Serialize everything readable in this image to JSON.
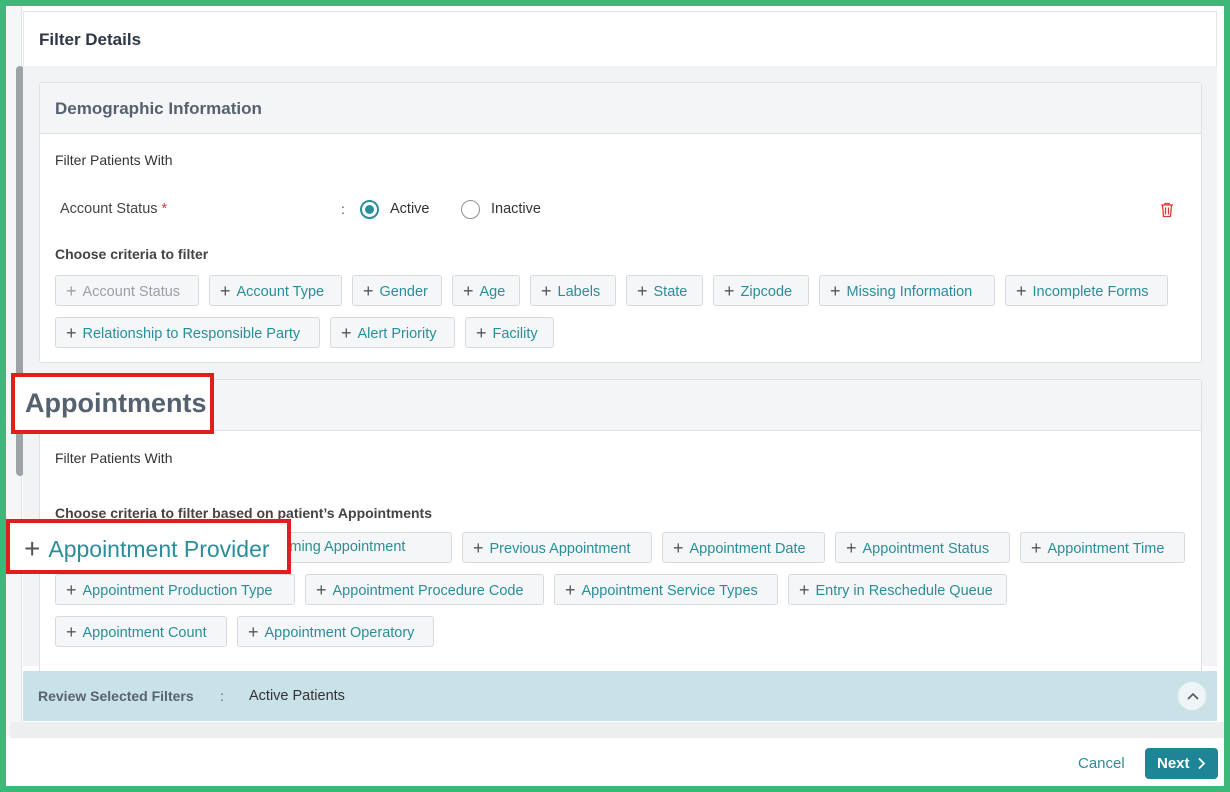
{
  "header": {
    "title": "Filter Details"
  },
  "demographic": {
    "title": "Demographic Information",
    "filter_with": "Filter Patients With",
    "account_status": {
      "label": "Account Status",
      "required_mark": "*",
      "separator": ":",
      "options": [
        {
          "label": "Active",
          "selected": true
        },
        {
          "label": "Inactive",
          "selected": false
        }
      ]
    },
    "criteria_heading": "Choose criteria to filter",
    "chips": [
      "Account Status",
      "Account Type",
      "Gender",
      "Age",
      "Labels",
      "State",
      "Zipcode",
      "Missing Information",
      "Incomplete Forms",
      "Relationship to Responsible Party",
      "Alert Priority",
      "Facility"
    ]
  },
  "appointments": {
    "title": "Appointments",
    "filter_with": "Filter Patients With",
    "criteria_heading": "Choose criteria to filter based on patient’s Appointments",
    "chips": [
      "Upcoming Appointment",
      "Previous Appointment",
      "Appointment Date",
      "Appointment Status",
      "Appointment Time",
      "Appointment Production Type",
      "Appointment Procedure Code",
      "Appointment Service Types",
      "Entry in Reschedule Queue",
      "Appointment Count",
      "Appointment Operatory"
    ],
    "truncated_chip_text": "pcoming Appointment",
    "callout_chip": "Appointment Provider"
  },
  "review": {
    "label": "Review Selected Filters",
    "separator": ":",
    "value": "Active Patients"
  },
  "footer": {
    "cancel": "Cancel",
    "next": "Next"
  },
  "colors": {
    "accent": "#2a8e9a",
    "primary_button": "#1e8597",
    "callout_border": "#e01e1e",
    "outer_border": "#3cb878",
    "review_bar": "#c9e2e8"
  }
}
